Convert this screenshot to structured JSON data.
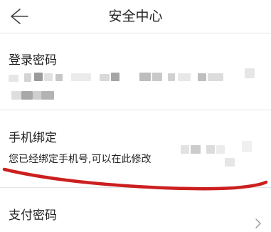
{
  "header": {
    "title": "安全中心",
    "back_icon": "arrow-left-icon"
  },
  "sections": {
    "login_password": {
      "title": "登录密码"
    },
    "phone_binding": {
      "title": "手机绑定",
      "hint": "您已经绑定手机号,可以在此修改"
    },
    "payment_password": {
      "title": "支付密码",
      "chevron_icon": "chevron-right-icon"
    }
  },
  "colors": {
    "scribble": "#cc1f1f",
    "divider": "#e5e5e5",
    "text": "#222222"
  }
}
